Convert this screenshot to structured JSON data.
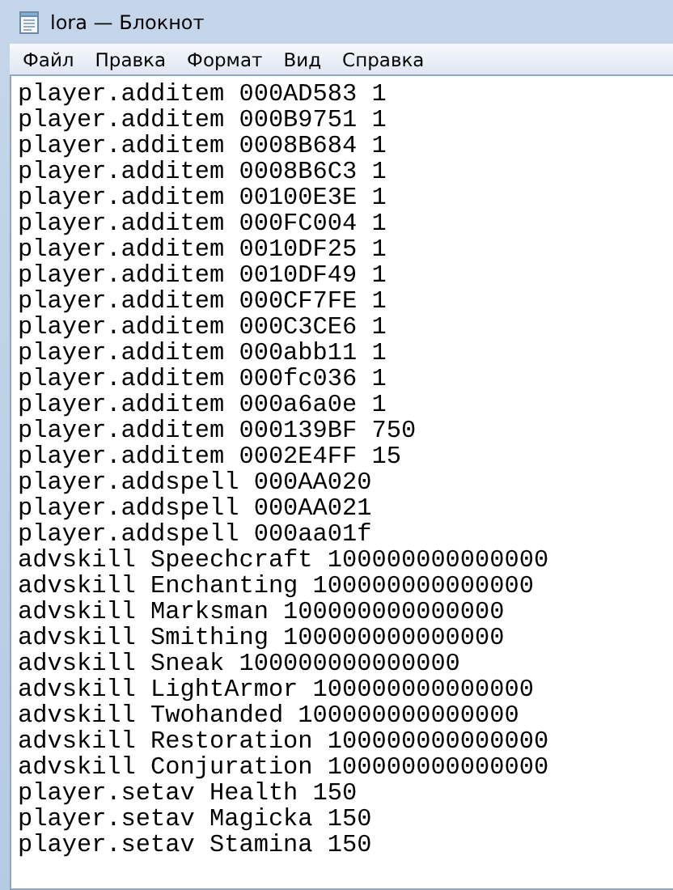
{
  "window": {
    "title": "lora — Блокнот"
  },
  "menu": [
    "Файл",
    "Правка",
    "Формат",
    "Вид",
    "Справка"
  ],
  "lines": [
    "player.additem 000AD583 1",
    "player.additem 000B9751 1",
    "player.additem 0008B684 1",
    "player.additem 0008B6C3 1",
    "player.additem 00100E3E 1",
    "player.additem 000FC004 1",
    "player.additem 0010DF25 1",
    "player.additem 0010DF49 1",
    "player.additem 000CF7FE 1",
    "player.additem 000C3CE6 1",
    "player.additem 000abb11 1",
    "player.additem 000fc036 1",
    "player.additem 000a6a0e 1",
    "player.additem 000139BF 750",
    "player.additem 0002E4FF 15",
    "player.addspell 000AA020",
    "player.addspell 000AA021",
    "player.addspell 000aa01f",
    "advskill Speechcraft 100000000000000",
    "advskill Enchanting 100000000000000",
    "advskill Marksman 100000000000000",
    "advskill Smithing 100000000000000",
    "advskill Sneak 100000000000000",
    "advskill LightArmor 100000000000000",
    "advskill Twohanded 100000000000000",
    "advskill Restoration 100000000000000",
    "advskill Conjuration 100000000000000",
    "player.setav Health 150",
    "player.setav Magicka 150",
    "player.setav Stamina 150"
  ]
}
